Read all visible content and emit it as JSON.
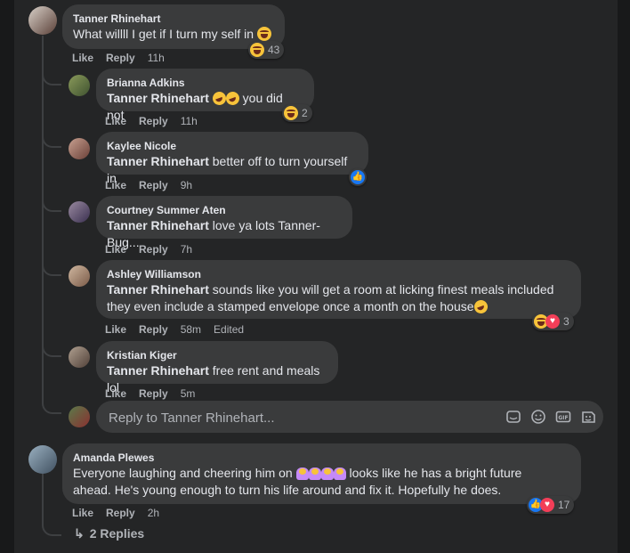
{
  "comments": [
    {
      "author": "Tanner Rhinehart",
      "text": "What willll I get if I turn my self in",
      "like": "Like",
      "reply": "Reply",
      "time": "11h",
      "reaction_count": "43"
    },
    {
      "author": "Brianna Adkins",
      "mention": "Tanner Rhinehart",
      "text": " you did not",
      "like": "Like",
      "reply": "Reply",
      "time": "11h",
      "reaction_count": "2"
    },
    {
      "author": "Kaylee Nicole",
      "mention": "Tanner Rhinehart",
      "text": " better off to turn yourself in",
      "like": "Like",
      "reply": "Reply",
      "time": "9h"
    },
    {
      "author": "Courtney Summer Aten",
      "mention": "Tanner Rhinehart",
      "text": " love ya lots Tanner-Bug...",
      "like": "Like",
      "reply": "Reply",
      "time": "7h"
    },
    {
      "author": "Ashley Williamson",
      "mention": "Tanner Rhinehart",
      "text_line1": " sounds like you will get a room at licking finest meals included",
      "text_line2": "they even include a stamped envelope once a month on the house",
      "like": "Like",
      "reply": "Reply",
      "time": "58m",
      "edited": "Edited",
      "reaction_count": "3"
    },
    {
      "author": "Kristian Kiger",
      "mention": "Tanner Rhinehart",
      "text": " free rent and meals lol",
      "like": "Like",
      "reply": "Reply",
      "time": "5m"
    },
    {
      "author": "Amanda Plewes",
      "text_line1": "Everyone laughing and cheering him on ",
      "text_line1b": " looks like he has a bright future",
      "text_line2": "ahead. He's young enough to turn his life around and fix it. Hopefully he does.",
      "like": "Like",
      "reply": "Reply",
      "time": "2h",
      "reaction_count": "17"
    }
  ],
  "reply_box": {
    "placeholder": "Reply to Tanner Rhinehart..."
  },
  "more_replies": "2 Replies",
  "icons": [
    "haha-emoji-icon",
    "like-emoji-icon",
    "love-emoji-icon",
    "sticker-icon",
    "emoji-icon",
    "gif-icon",
    "camera-icon",
    "reply-arrow-icon"
  ],
  "colors": {
    "background": "#242526",
    "bubble": "#3a3b3c",
    "text": "#e4e6eb",
    "muted": "#b0b3b8",
    "like": "#1877f2",
    "love": "#f33e58",
    "haha": "#f7c33a"
  }
}
